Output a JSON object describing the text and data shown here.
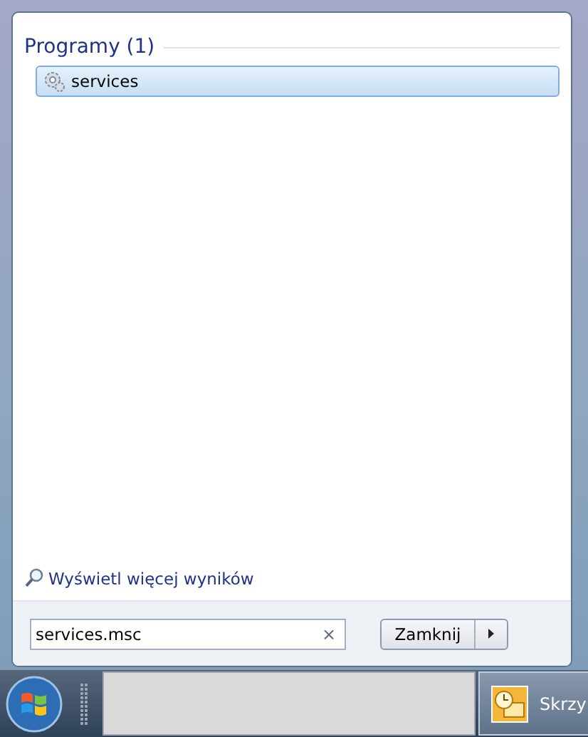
{
  "results": {
    "group_title": "Programy (1)",
    "items": [
      {
        "label": "services",
        "selected": true
      }
    ]
  },
  "more_results": "Wyświetl więcej wyników",
  "search": {
    "value": "services.msc",
    "clear": "×"
  },
  "shutdown": {
    "label": "Zamknij"
  },
  "taskbar": {
    "buttons": [
      {
        "label": "Skrzy"
      }
    ]
  }
}
